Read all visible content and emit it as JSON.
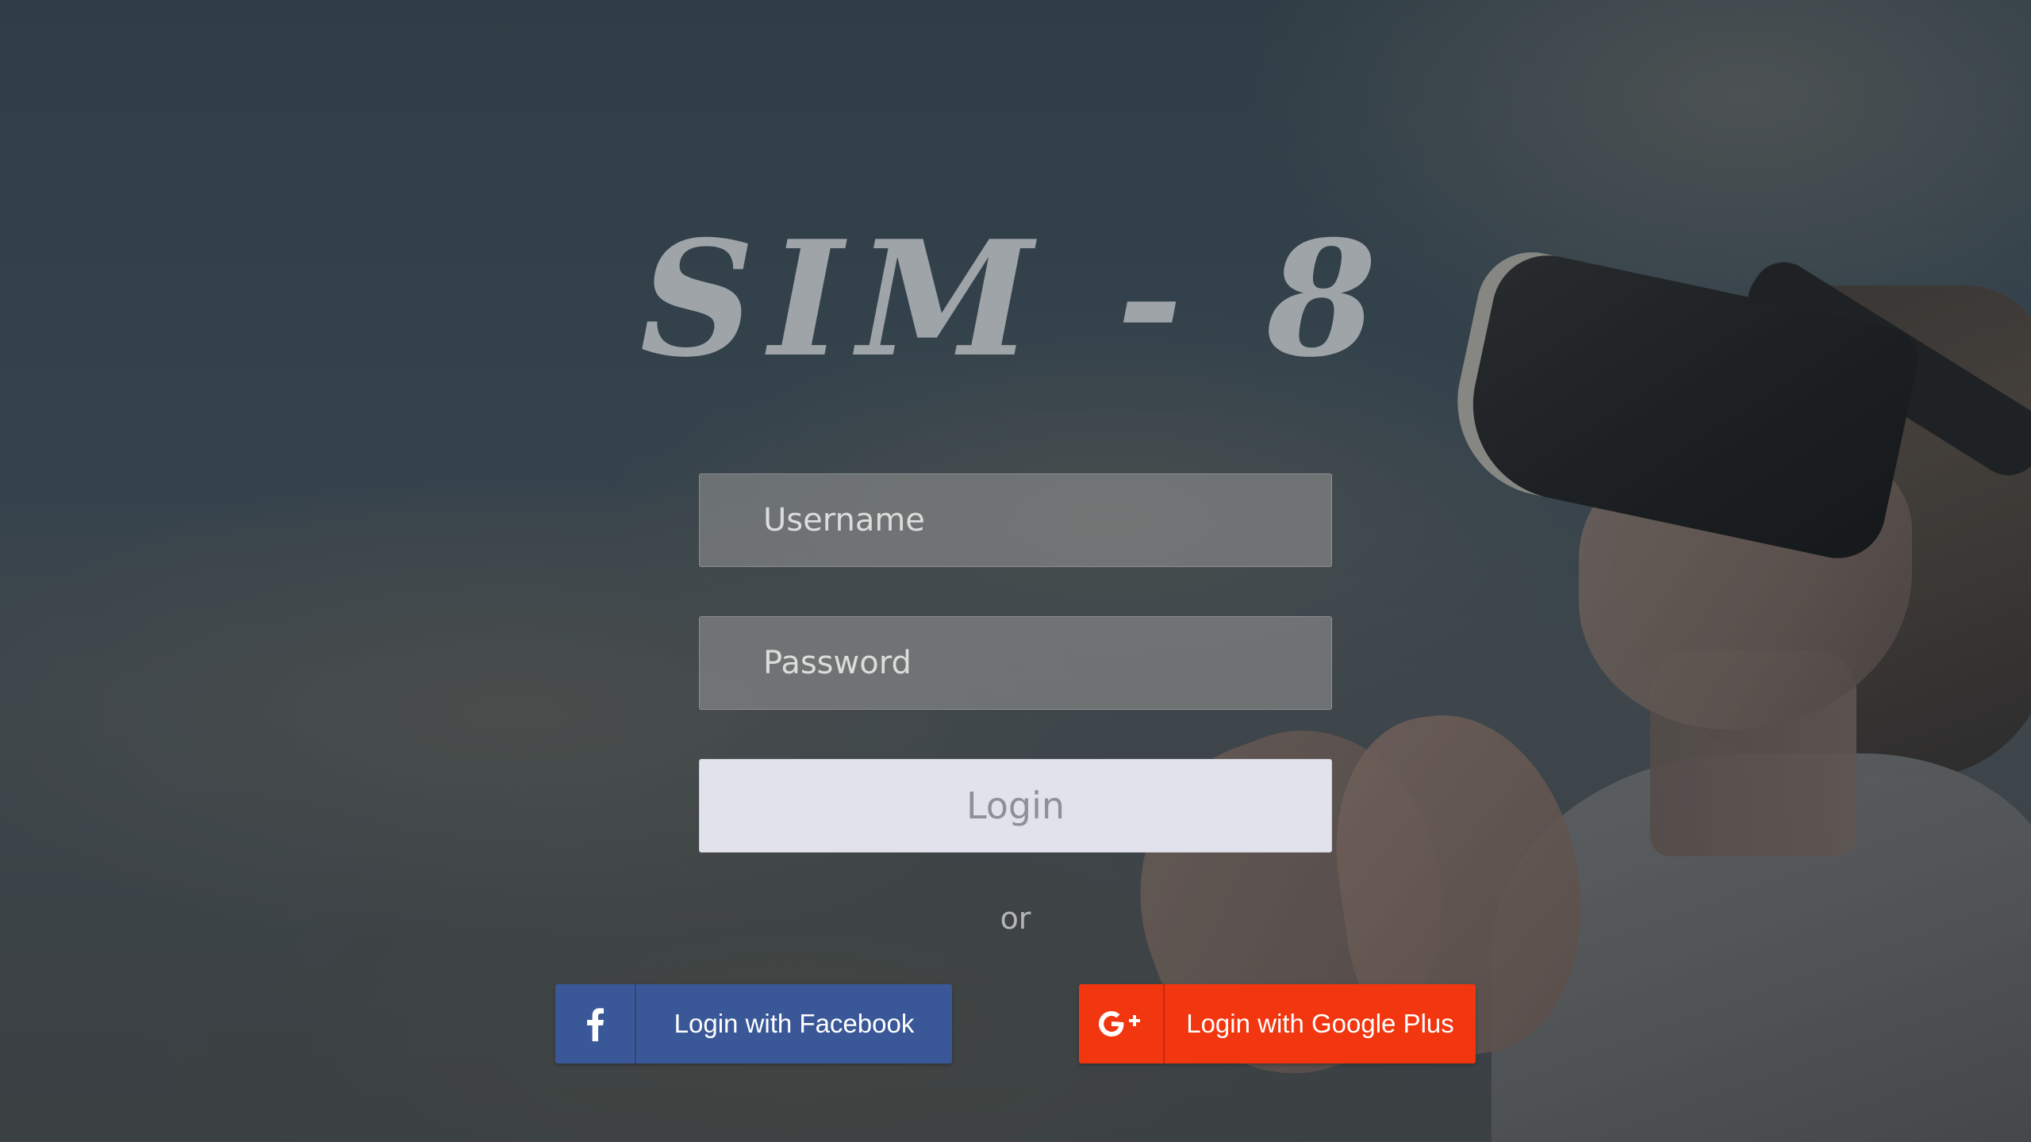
{
  "app": {
    "logo_text": "SIM - 8"
  },
  "form": {
    "username_placeholder": "Username",
    "username_value": "",
    "password_placeholder": "Password",
    "password_value": "",
    "login_label": "Login",
    "divider_text": "or"
  },
  "social": {
    "facebook": {
      "label": "Login with Facebook",
      "icon": "facebook-icon",
      "color": "#3a5897"
    },
    "google_plus": {
      "label": "Login with Google Plus",
      "icon": "google-plus-icon",
      "color": "#f2360f"
    }
  },
  "theme": {
    "accent_button_bg": "#e2e2ec",
    "field_bg": "rgba(150,150,150,0.55)"
  }
}
